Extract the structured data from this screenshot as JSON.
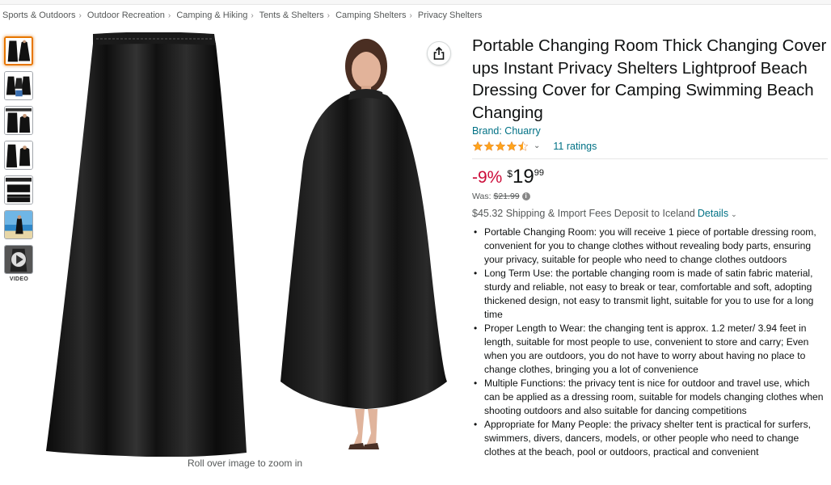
{
  "breadcrumb": [
    "Sports & Outdoors",
    "Outdoor Recreation",
    "Camping & Hiking",
    "Tents & Shelters",
    "Camping Shelters",
    "Privacy Shelters"
  ],
  "gallery": {
    "thumbnail_count": 7,
    "selected_index": 0,
    "video_label": "VIDEO",
    "zoom_caption": "Roll over image to zoom in"
  },
  "product": {
    "title": "Portable Changing Room Thick Changing Cover ups Instant Privacy Shelters Lightproof Beach Dressing Cover for Camping Swimming Beach Changing",
    "brand": "Brand: Chuarry",
    "rating": 4.5,
    "ratings_count": "11 ratings",
    "discount": "-9%",
    "price_symbol": "$",
    "price_whole": "19",
    "price_fraction": "99",
    "was_label": "Was:",
    "was_price": "$21.99",
    "shipping": "$45.32 Shipping & Import Fees Deposit to Iceland",
    "details_link": "Details",
    "bullets": [
      "Portable Changing Room: you will receive 1 piece of portable dressing room, convenient for you to change clothes without revealing body parts, ensuring your privacy, suitable for people who need to change clothes outdoors",
      "Long Term Use: the portable changing room is made of satin fabric material, sturdy and reliable, not easy to break or tear, comfortable and soft, adopting thickened design, not easy to transmit light, suitable for you to use for a long time",
      "Proper Length to Wear: the changing tent is approx. 1.2 meter/ 3.94 feet in length, suitable for most people to use, convenient to store and carry; Even when you are outdoors, you do not have to worry about having no place to change clothes, bringing you a lot of convenience",
      "Multiple Functions: the privacy tent is nice for outdoor and travel use, which can be applied as a dressing room, suitable for models changing clothes when shooting outdoors and also suitable for dancing competitions",
      "Appropriate for Many People: the privacy shelter tent is practical for surfers, swimmers, divers, dancers, models, or other people who need to change clothes at the beach, pool or outdoors, practical and convenient"
    ]
  },
  "colors": {
    "link": "#007185",
    "discount": "#cc0c39",
    "star": "#ffa41c",
    "selected_thumb": "#e77600"
  },
  "icons": {
    "share": "share-icon",
    "info": "info-icon",
    "play": "play-icon",
    "star": "star-icon"
  }
}
